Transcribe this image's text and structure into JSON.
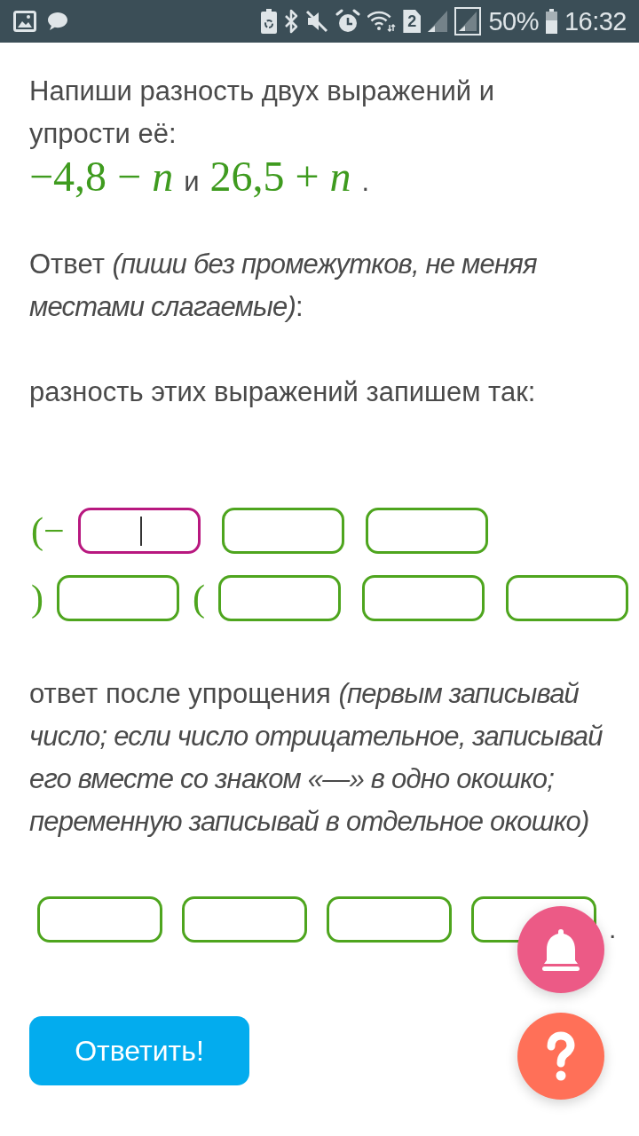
{
  "status_bar": {
    "sim_badge": "2",
    "battery": "50%",
    "time": "16:32"
  },
  "task": {
    "prompt": "Напиши разность двух выражений и упрости её:",
    "expression": [
      {
        "kind": "math",
        "text": "−4,8 − *n*"
      },
      {
        "kind": "text",
        "text": "и"
      },
      {
        "kind": "math",
        "text": "26,5 + *n*"
      },
      {
        "kind": "text",
        "text": "."
      }
    ]
  },
  "instruction": "Ответ *(пиши без промежутков, не меняя местами слагаемые)*:",
  "difference_label": "разность этих выражений запишем так:",
  "difference_rows": [
    [
      {
        "kind": "text",
        "text": "(−"
      },
      {
        "kind": "field",
        "focused": true
      },
      {
        "kind": "field",
        "focused": false
      },
      {
        "kind": "field",
        "focused": false
      }
    ],
    [
      {
        "kind": "text",
        "text": ")"
      },
      {
        "kind": "field",
        "focused": false
      },
      {
        "kind": "text",
        "text": "("
      },
      {
        "kind": "field",
        "focused": false
      },
      {
        "kind": "field",
        "focused": false
      },
      {
        "kind": "field",
        "focused": false
      }
    ]
  ],
  "simplified_label": "ответ после упрощения *(первым записывай число; если число отрицательное, записывай его вместе со знаком «—» в одно окошко; переменную записывай в отдельное окошко)*",
  "simplified_fields": [
    {
      "focused": false
    },
    {
      "focused": false
    },
    {
      "focused": false
    },
    {
      "focused": false
    }
  ],
  "simplified_end": ".",
  "submit_button": "Ответить!"
}
